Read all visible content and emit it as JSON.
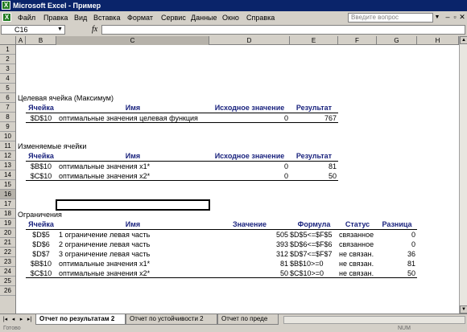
{
  "window": {
    "title": "Microsoft Excel - Пример"
  },
  "menu": {
    "items": [
      "Файл",
      "Правка",
      "Вид",
      "Вставка",
      "Формат",
      "Сервис",
      "Данные",
      "Окно",
      "Справка"
    ],
    "help_placeholder": "Введите вопрос",
    "win_buttons": [
      "–",
      "▫",
      "✕"
    ]
  },
  "formula_bar": {
    "cell_ref": "C16",
    "fx": "fx",
    "formula": ""
  },
  "columns": [
    "A",
    "B",
    "C",
    "D",
    "E",
    "F",
    "G",
    "H"
  ],
  "selected_column": "C",
  "rows": [
    "1",
    "2",
    "3",
    "4",
    "5",
    "6",
    "7",
    "8",
    "9",
    "10",
    "11",
    "12",
    "13",
    "14",
    "15",
    "16",
    "17",
    "18",
    "19",
    "20",
    "21",
    "22",
    "23",
    "24",
    "25",
    "26"
  ],
  "selected_row": "16",
  "report": {
    "target": {
      "section_title": "Целевая ячейка (Максимум)",
      "headers": [
        "Ячейка",
        "Имя",
        "Исходное значение",
        "Результат"
      ],
      "rows": [
        [
          "$D$10",
          "оптимальные значения целевая функция",
          "0",
          "767"
        ]
      ]
    },
    "variables": {
      "section_title": "Изменяемые ячейки",
      "headers": [
        "Ячейка",
        "Имя",
        "Исходное значение",
        "Результат"
      ],
      "rows": [
        [
          "$B$10",
          "оптимальные значения х1*",
          "0",
          "81"
        ],
        [
          "$C$10",
          "оптимальные значения х2*",
          "0",
          "50"
        ]
      ]
    },
    "constraints": {
      "section_title": "Ограничения",
      "headers": [
        "Ячейка",
        "Имя",
        "Значение",
        "Формула",
        "Статус",
        "Разница"
      ],
      "rows": [
        [
          "$D$5",
          "1 ограничение  левая часть",
          "505",
          "$D$5<=$F$5",
          "связанное",
          "0"
        ],
        [
          "$D$6",
          "2 ограничение  левая часть",
          "393",
          "$D$6<=$F$6",
          "связанное",
          "0"
        ],
        [
          "$D$7",
          "3 ограничение  левая часть",
          "312",
          "$D$7<=$F$7",
          "не связан.",
          "36"
        ],
        [
          "$B$10",
          "оптимальные значения х1*",
          "81",
          "$B$10>=0",
          "не связан.",
          "81"
        ],
        [
          "$C$10",
          "оптимальные значения х2*",
          "50",
          "$C$10>=0",
          "не связан.",
          "50"
        ]
      ]
    }
  },
  "sheet_tabs": [
    "Отчет по результатам 2",
    "Отчет по устойчивости 2",
    "Отчет по преде"
  ],
  "tab_nav": [
    "|◂",
    "◂",
    "▸",
    "▸|"
  ],
  "status": {
    "left": "Готово",
    "right": "NUM"
  }
}
